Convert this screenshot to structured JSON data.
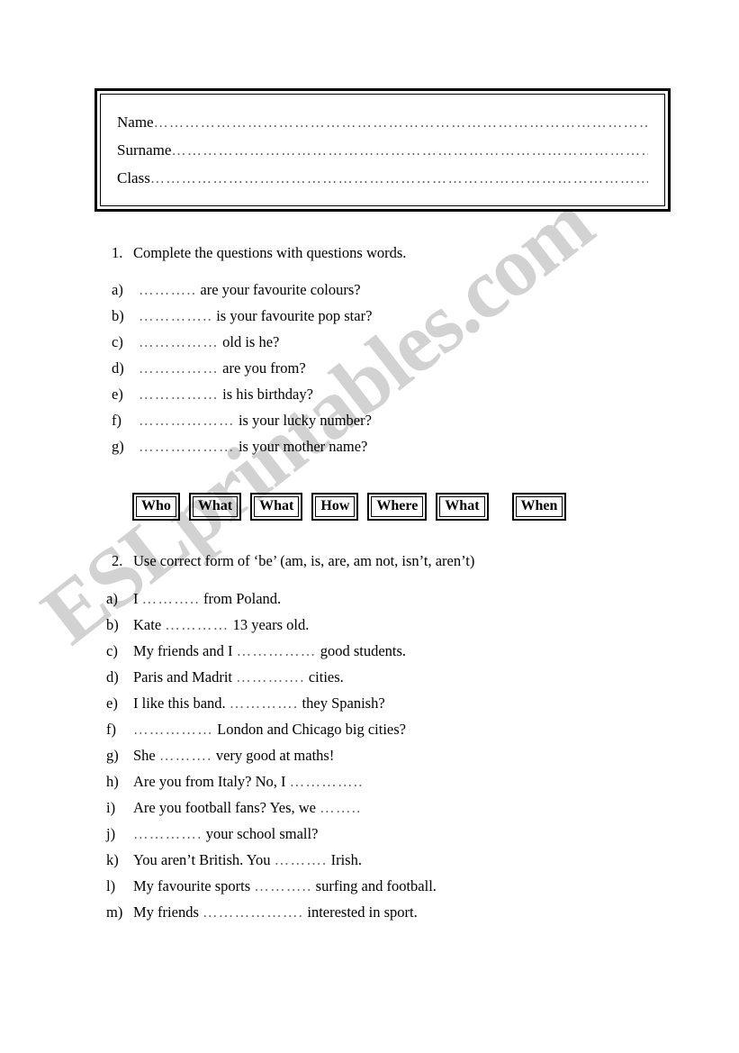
{
  "watermark": {
    "text": "ESLprintables.com",
    "color": "#d2d2d2"
  },
  "header": {
    "fields": [
      {
        "label": "Name",
        "dots": "……………………………………………………………………………………………………………"
      },
      {
        "label": "Surname",
        "dots": "……………………………………………………………………………………………………"
      },
      {
        "label": "Class",
        "dots": "……………………………………………………………………………………………………………"
      }
    ]
  },
  "exercise1": {
    "number": "1.",
    "instruction": "Complete the questions with questions words.",
    "items": [
      {
        "marker": "a)",
        "blank": "………..",
        "text": " are your favourite colours?"
      },
      {
        "marker": "b)",
        "blank": "…………..",
        "text": " is your favourite pop star?"
      },
      {
        "marker": "c)",
        "blank": "……………",
        "text": " old is he?"
      },
      {
        "marker": "d)",
        "blank": "……………",
        "text": " are you from?"
      },
      {
        "marker": "e)",
        "blank": "……………",
        "text": " is his birthday?"
      },
      {
        "marker": "f)",
        "blank": "………………",
        "text": " is your lucky number?"
      },
      {
        "marker": "g)",
        "blank": "………………",
        "text": " is your mother name?"
      }
    ],
    "word_bank": [
      {
        "word": "Who",
        "gap_before": false
      },
      {
        "word": "What",
        "gap_before": false
      },
      {
        "word": "What",
        "gap_before": false
      },
      {
        "word": "How",
        "gap_before": false
      },
      {
        "word": "Where",
        "gap_before": false
      },
      {
        "word": "What",
        "gap_before": false
      },
      {
        "word": "When",
        "gap_before": true
      }
    ]
  },
  "exercise2": {
    "number": "2.",
    "instruction": "Use correct form of ‘be’ (am, is, are, am not, isn’t, aren’t)",
    "items": [
      {
        "marker": "a)",
        "before": "I ",
        "blank": "………..",
        "after": " from Poland."
      },
      {
        "marker": "b)",
        "before": "Kate ",
        "blank": "…………",
        "after": " 13 years old."
      },
      {
        "marker": "c)",
        "before": "My friends and I ",
        "blank": "……………",
        "after": " good students."
      },
      {
        "marker": "d)",
        "before": "Paris and Madrit ",
        "blank": "………….",
        "after": " cities."
      },
      {
        "marker": "e)",
        "before": "I like this band.  ",
        "blank": "………….",
        "after": " they Spanish?"
      },
      {
        "marker": "f)",
        "before": "",
        "blank": "……………",
        "after": " London and Chicago big cities?"
      },
      {
        "marker": "g)",
        "before": "She ",
        "blank": "……….",
        "after": " very good at maths!"
      },
      {
        "marker": "h)",
        "before": "Are you from Italy? No, I ",
        "blank": "…………..",
        "after": ""
      },
      {
        "marker": "i)",
        "before": "Are you football fans? Yes, we ",
        "blank": "……..",
        "after": ""
      },
      {
        "marker": "j)",
        "before": "",
        "blank": "………….",
        "after": " your school small?"
      },
      {
        "marker": "k)",
        "before": " You aren’t British. You ",
        "blank": "……….",
        "after": " Irish."
      },
      {
        "marker": "l)",
        "before": "My favourite sports ",
        "blank": "………..",
        "after": " surfing and football."
      },
      {
        "marker": "m)",
        "before": "My friends ",
        "blank": "……………….",
        "after": " interested in sport."
      }
    ]
  }
}
